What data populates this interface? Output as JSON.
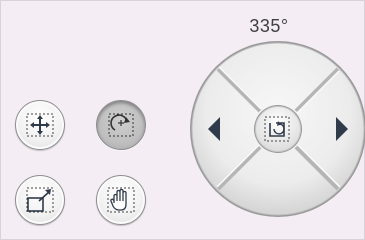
{
  "rotation": {
    "angle_label": "335°"
  },
  "tools": [
    {
      "name": "move-tool",
      "icon": "move-arrows-icon",
      "active": false
    },
    {
      "name": "rotate-tool",
      "icon": "rotate-icon",
      "active": true
    },
    {
      "name": "resize-tool",
      "icon": "resize-icon",
      "active": false
    },
    {
      "name": "pan-tool",
      "icon": "hand-icon",
      "active": false
    }
  ],
  "joystick": {
    "left_icon": "triangle-left-icon",
    "right_icon": "triangle-right-icon",
    "center_icon": "rotate-reset-icon"
  },
  "colors": {
    "background": "#f4edf4",
    "button_face": "#f2f2f2",
    "icon_dark": "#2f3b4a"
  }
}
